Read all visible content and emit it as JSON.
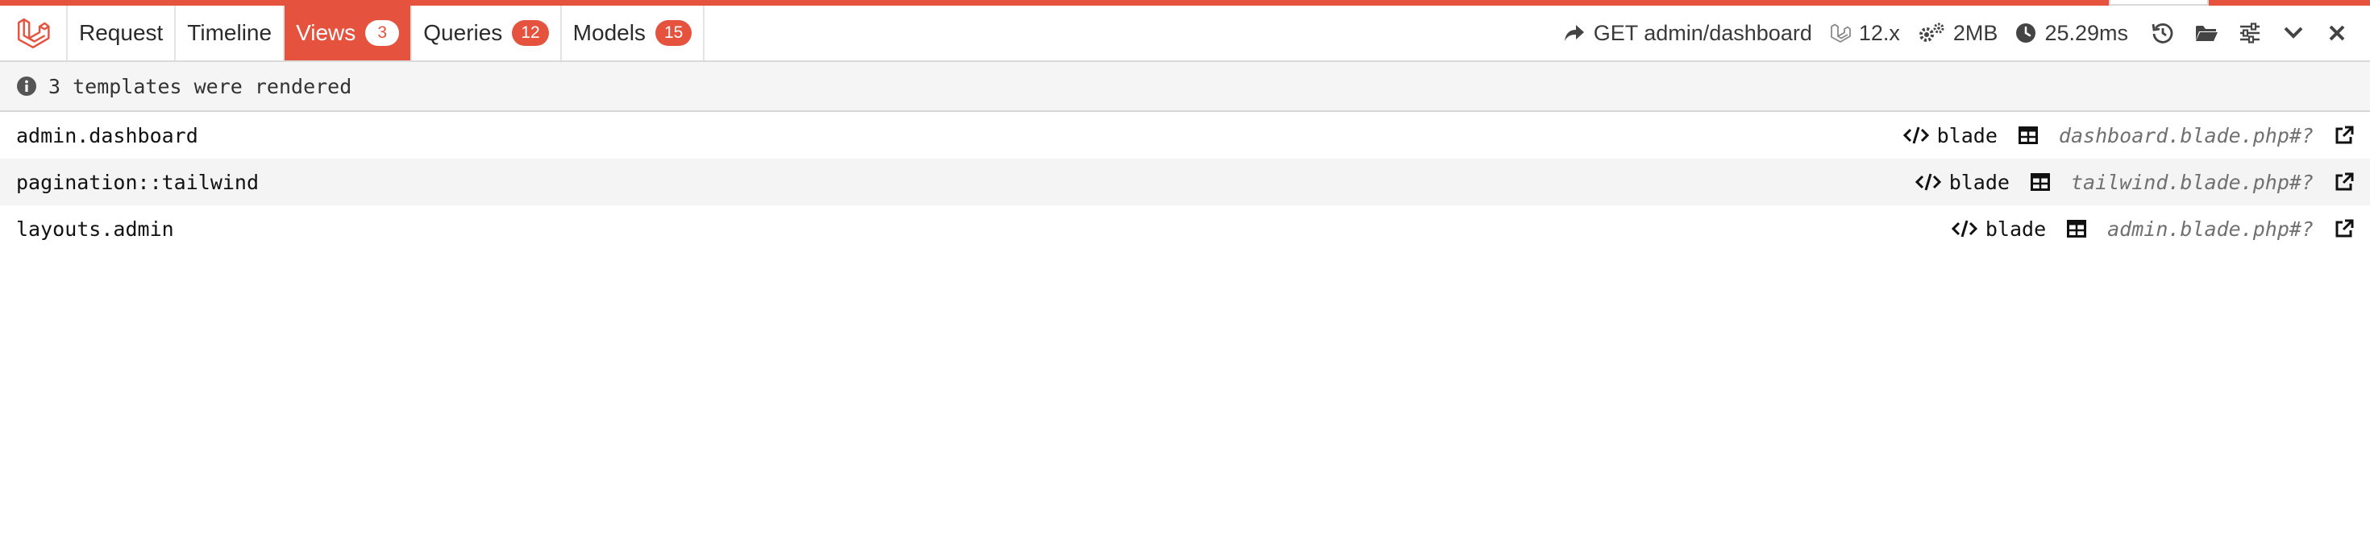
{
  "colors": {
    "accent": "#e5533e",
    "toolbar_bg": "#ffffff",
    "info_bg": "#f5f5f5"
  },
  "tabs": [
    {
      "label": "Request",
      "badge": ""
    },
    {
      "label": "Timeline",
      "badge": ""
    },
    {
      "label": "Views",
      "badge": "3",
      "active": true
    },
    {
      "label": "Queries",
      "badge": "12"
    },
    {
      "label": "Models",
      "badge": "15"
    }
  ],
  "meta": {
    "route": "GET admin/dashboard",
    "version": "12.x",
    "memory": "2MB",
    "duration": "25.29ms"
  },
  "icons": {
    "logo": "laravel-logo-icon",
    "route": "share-arrow-icon",
    "version": "laravel-icon",
    "memory": "cogs-icon",
    "duration": "clock-icon",
    "actions": [
      "history-icon",
      "folder-open-icon",
      "sliders-icon",
      "chevron-down-icon",
      "close-icon"
    ]
  },
  "info": {
    "message": "3 templates were rendered"
  },
  "templates": [
    {
      "name": "admin.dashboard",
      "type": "blade",
      "file": "dashboard.blade.php#?"
    },
    {
      "name": "pagination::tailwind",
      "type": "blade",
      "file": "tailwind.blade.php#?"
    },
    {
      "name": "layouts.admin",
      "type": "blade",
      "file": "admin.blade.php#?"
    }
  ]
}
